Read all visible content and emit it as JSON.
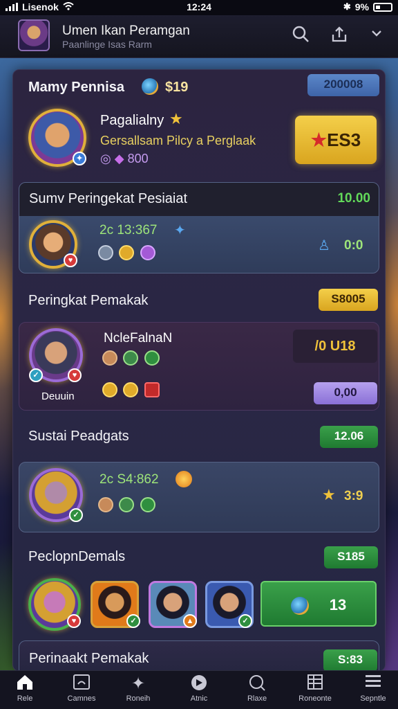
{
  "status": {
    "carrier": "Lisenok",
    "time": "12:24",
    "battery": "9%"
  },
  "header": {
    "title": "Umen Ikan Peramgan",
    "subtitle": "Paanlinge Isas Rarm"
  },
  "top_card": {
    "player_label": "Mamy Pennisa",
    "coins": "$19",
    "score_pill": "200008",
    "name": "Pagalialny",
    "desc": "Gersallsam Pilcy a Perglaak",
    "gems": "800",
    "action": "ES3"
  },
  "section1": {
    "title": "Sumv Peringekat Pesiaiat",
    "value": "10.00",
    "row_text": "2c 13:367",
    "right": "0:0"
  },
  "section2": {
    "title": "Peringkat Pemakak",
    "pill": "S8005",
    "name": "NcleFalnaN",
    "caption": "Deuuin",
    "value": "/0 U18",
    "pill2": "0,00"
  },
  "section3": {
    "title": "Sustai Peadgats",
    "pill": "12.06",
    "row_text": "2c S4:862",
    "right": "3:9"
  },
  "section4": {
    "title": "PeclopnDemals",
    "pill": "S185",
    "button": "13"
  },
  "section5": {
    "title": "Perinaakt Pemakak",
    "pill": "S:83"
  },
  "nav": [
    {
      "label": "Rele",
      "icon": "home-icon"
    },
    {
      "label": "Camnes",
      "icon": "screen-icon"
    },
    {
      "label": "Roneih",
      "icon": "star-icon"
    },
    {
      "label": "Atnic",
      "icon": "compass-icon"
    },
    {
      "label": "Rlaxe",
      "icon": "search-icon"
    },
    {
      "label": "Roneonte",
      "icon": "grid-icon"
    },
    {
      "label": "Sepntle",
      "icon": "menu-icon"
    }
  ],
  "colors": {
    "gold": "#e7b53a",
    "green": "#2f8f3f",
    "blue": "#4d75b9",
    "lavender": "#a48ce6"
  }
}
